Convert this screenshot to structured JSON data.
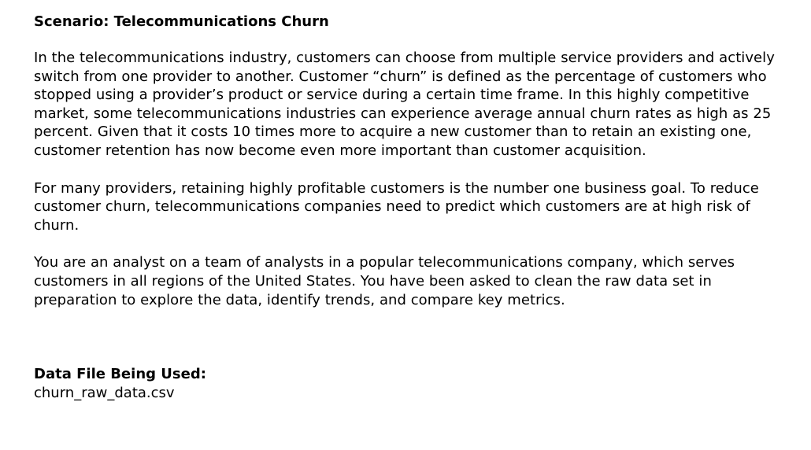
{
  "document": {
    "title": "Scenario: Telecommunications Churn",
    "paragraphs": [
      "In the telecommunications industry, customers can choose from multiple service providers and actively switch from one provider to another. Customer “churn” is defined as the percentage of customers who stopped using a provider’s product or service during a certain time frame. In this highly competitive market, some telecommunications industries can experience average annual churn rates as high as 25 percent. Given that it costs 10 times more to acquire a new customer than to retain an existing one, customer retention has now become even more important than customer acquisition.",
      "For many providers, retaining highly profitable customers is the number one business goal. To reduce customer churn, telecommunications companies need to predict which customers are at high risk of churn.",
      "You are an analyst on a team of analysts in a popular telecommunications company, which serves customers in all regions of the United States. You have been asked to clean the raw data set in preparation to explore the data, identify trends, and compare key metrics."
    ],
    "data_file_label": "Data File Being Used:",
    "data_file_name": "churn_raw_data.csv"
  }
}
